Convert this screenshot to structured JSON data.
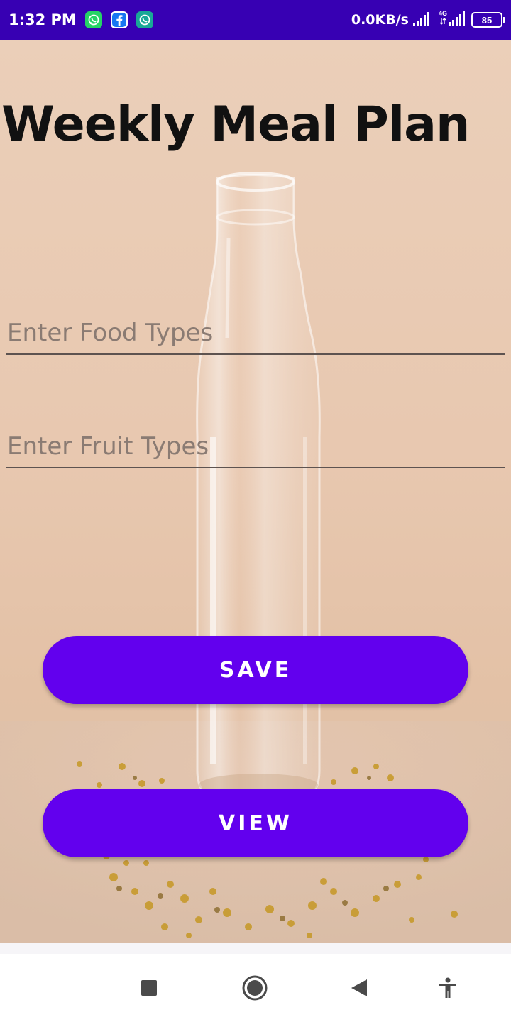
{
  "status_bar": {
    "time": "1:32 PM",
    "network_speed": "0.0KB/s",
    "network_type": "4G",
    "battery_level": "85",
    "notification_icons": [
      "whatsapp-icon",
      "facebook-icon",
      "whatsapp-business-icon"
    ]
  },
  "main": {
    "title": "Weekly Meal Plan",
    "food_input": {
      "placeholder": "Enter Food Types",
      "value": ""
    },
    "fruit_input": {
      "placeholder": "Enter Fruit Types",
      "value": ""
    },
    "save_label": "SAVE",
    "view_label": "VIEW"
  },
  "colors": {
    "status_bar": "#3700b3",
    "button": "#6200ee",
    "button_text": "#ffffff",
    "title_text": "#111111"
  },
  "nav_bar": {
    "icons": [
      "recent-apps-icon",
      "home-icon",
      "back-icon",
      "accessibility-icon"
    ]
  }
}
